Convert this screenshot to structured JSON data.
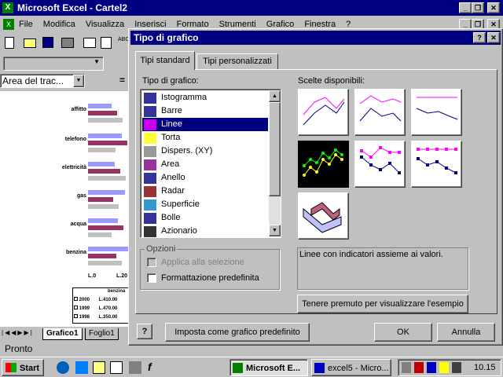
{
  "app": {
    "title": "Microsoft Excel - Cartel2",
    "menu": [
      "File",
      "Modifica",
      "Visualizza",
      "Inserisci",
      "Formato",
      "Strumenti",
      "Grafico",
      "Finestra",
      "?"
    ],
    "name_box": "Area del trac...",
    "status": "Pronto",
    "sheet_tabs": [
      "Grafico1",
      "Foglio1"
    ]
  },
  "chart_labels": [
    "affitto",
    "telefono",
    "elettricità",
    "gas",
    "acqua",
    "benzina"
  ],
  "chart_axis": [
    "L.0",
    "L.20"
  ],
  "legend_rows": [
    {
      "year": "2000",
      "value": "L.410.00"
    },
    {
      "year": "1999",
      "value": "L.470.00"
    },
    {
      "year": "1998",
      "value": "L.350.00"
    }
  ],
  "legend_header": "benzina",
  "dialog": {
    "title": "Tipo di grafico",
    "tabs": [
      "Tipi standard",
      "Tipi personalizzati"
    ],
    "list_label": "Tipo di grafico:",
    "subtypes_label": "Scelte disponibili:",
    "types": [
      {
        "label": "Istogramma",
        "icon": "column-chart-icon"
      },
      {
        "label": "Barre",
        "icon": "bar-chart-icon"
      },
      {
        "label": "Linee",
        "icon": "line-chart-icon"
      },
      {
        "label": "Torta",
        "icon": "pie-chart-icon"
      },
      {
        "label": "Dispers. (XY)",
        "icon": "scatter-chart-icon"
      },
      {
        "label": "Area",
        "icon": "area-chart-icon"
      },
      {
        "label": "Anello",
        "icon": "doughnut-chart-icon"
      },
      {
        "label": "Radar",
        "icon": "radar-chart-icon"
      },
      {
        "label": "Superficie",
        "icon": "surface-chart-icon"
      },
      {
        "label": "Bolle",
        "icon": "bubble-chart-icon"
      },
      {
        "label": "Azionario",
        "icon": "stock-chart-icon"
      }
    ],
    "selected_type": "Linee",
    "options_label": "Opzioni",
    "option_apply": "Applica alla selezione",
    "option_default_format": "Formattazione predefinita",
    "description": "Linee con indicatori assieme ai valori.",
    "preview_button": "Tenere premuto per visualizzare l'esempio",
    "set_default_button": "Imposta come grafico predefinito",
    "ok": "OK",
    "cancel": "Annulla"
  },
  "taskbar": {
    "start": "Start",
    "tasks": [
      "Microsoft E...",
      "excel5 - Micro..."
    ],
    "clock": "10.15"
  },
  "colors": {
    "title": "#000080",
    "selection": "#000080",
    "desktop": "#c0c0c0"
  }
}
